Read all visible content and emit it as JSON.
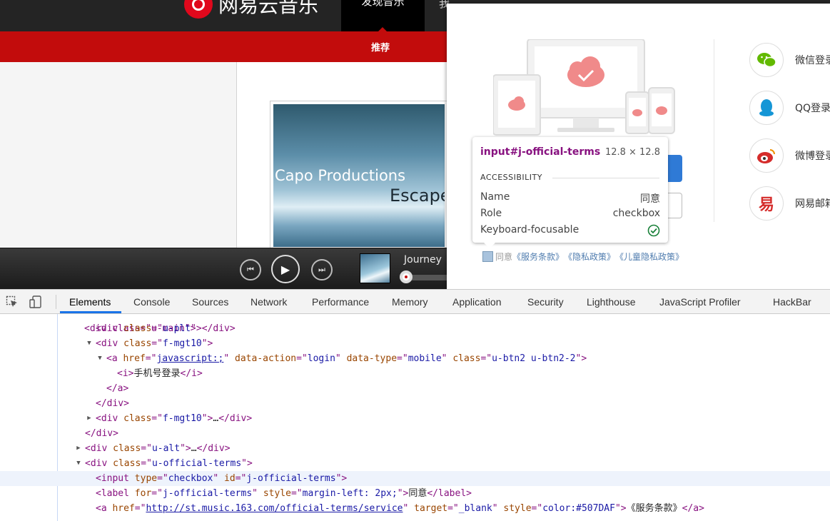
{
  "site": {
    "logo_text": "网易云音乐",
    "nav_active": "发现音乐",
    "nav_next": "我",
    "subnav_item": "推荐",
    "banner_line1": "Capo Productions",
    "banner_line2": "Escape",
    "player_track": "Journey"
  },
  "login_modal": {
    "social": [
      {
        "label": "微信登录",
        "icon": "wechat-icon",
        "color": "#62b900"
      },
      {
        "label": "QQ登录",
        "icon": "qq-icon",
        "color": "#1596d6"
      },
      {
        "label": "微博登录",
        "icon": "weibo-icon",
        "color": "#d52c2b"
      },
      {
        "label": "网易邮箱",
        "icon": "netease-mail-icon",
        "color": "#d52c2b"
      }
    ],
    "terms": {
      "agree": "同意",
      "service": "《服务条款》",
      "privacy": "《隐私政策》",
      "children": "《儿童隐私政策》"
    }
  },
  "tooltip": {
    "element": "input#j-official-terms",
    "size": "12.8 × 12.8",
    "section": "ACCESSIBILITY",
    "rows": [
      {
        "key": "Name",
        "value": "同意"
      },
      {
        "key": "Role",
        "value": "checkbox"
      },
      {
        "key": "Keyboard-focusable",
        "value": ""
      }
    ]
  },
  "devtools": {
    "tabs": [
      "Elements",
      "Console",
      "Sources",
      "Network",
      "Performance",
      "Memory",
      "Application",
      "Security",
      "Lighthouse",
      "JavaScript Profiler",
      "HackBar"
    ],
    "active_tab": "Elements",
    "dom_lines": {
      "l0": "<div class=\"u-main\">",
      "l1_tag": "div",
      "l1_class": "u-plt",
      "l2_class": "f-mgt10",
      "l3_href": "javascript:;",
      "l3_action": "login",
      "l3_type": "mobile",
      "l3_class": "u-btn2 u-btn2-2",
      "l4_text": "手机号登录",
      "l6_class": "f-mgt10",
      "l7_class": "u-alt",
      "l8_class": "u-official-terms",
      "l9_type": "checkbox",
      "l9_id": "j-official-terms",
      "l10_for": "j-official-terms",
      "l10_style": "margin-left: 2px;",
      "l10_text": "同意",
      "l11_href": "http://st.music.163.com/official-terms/service",
      "l11_target": "_blank",
      "l11_style": "color:#507DAF",
      "l11_text": "《服务条款》"
    }
  }
}
